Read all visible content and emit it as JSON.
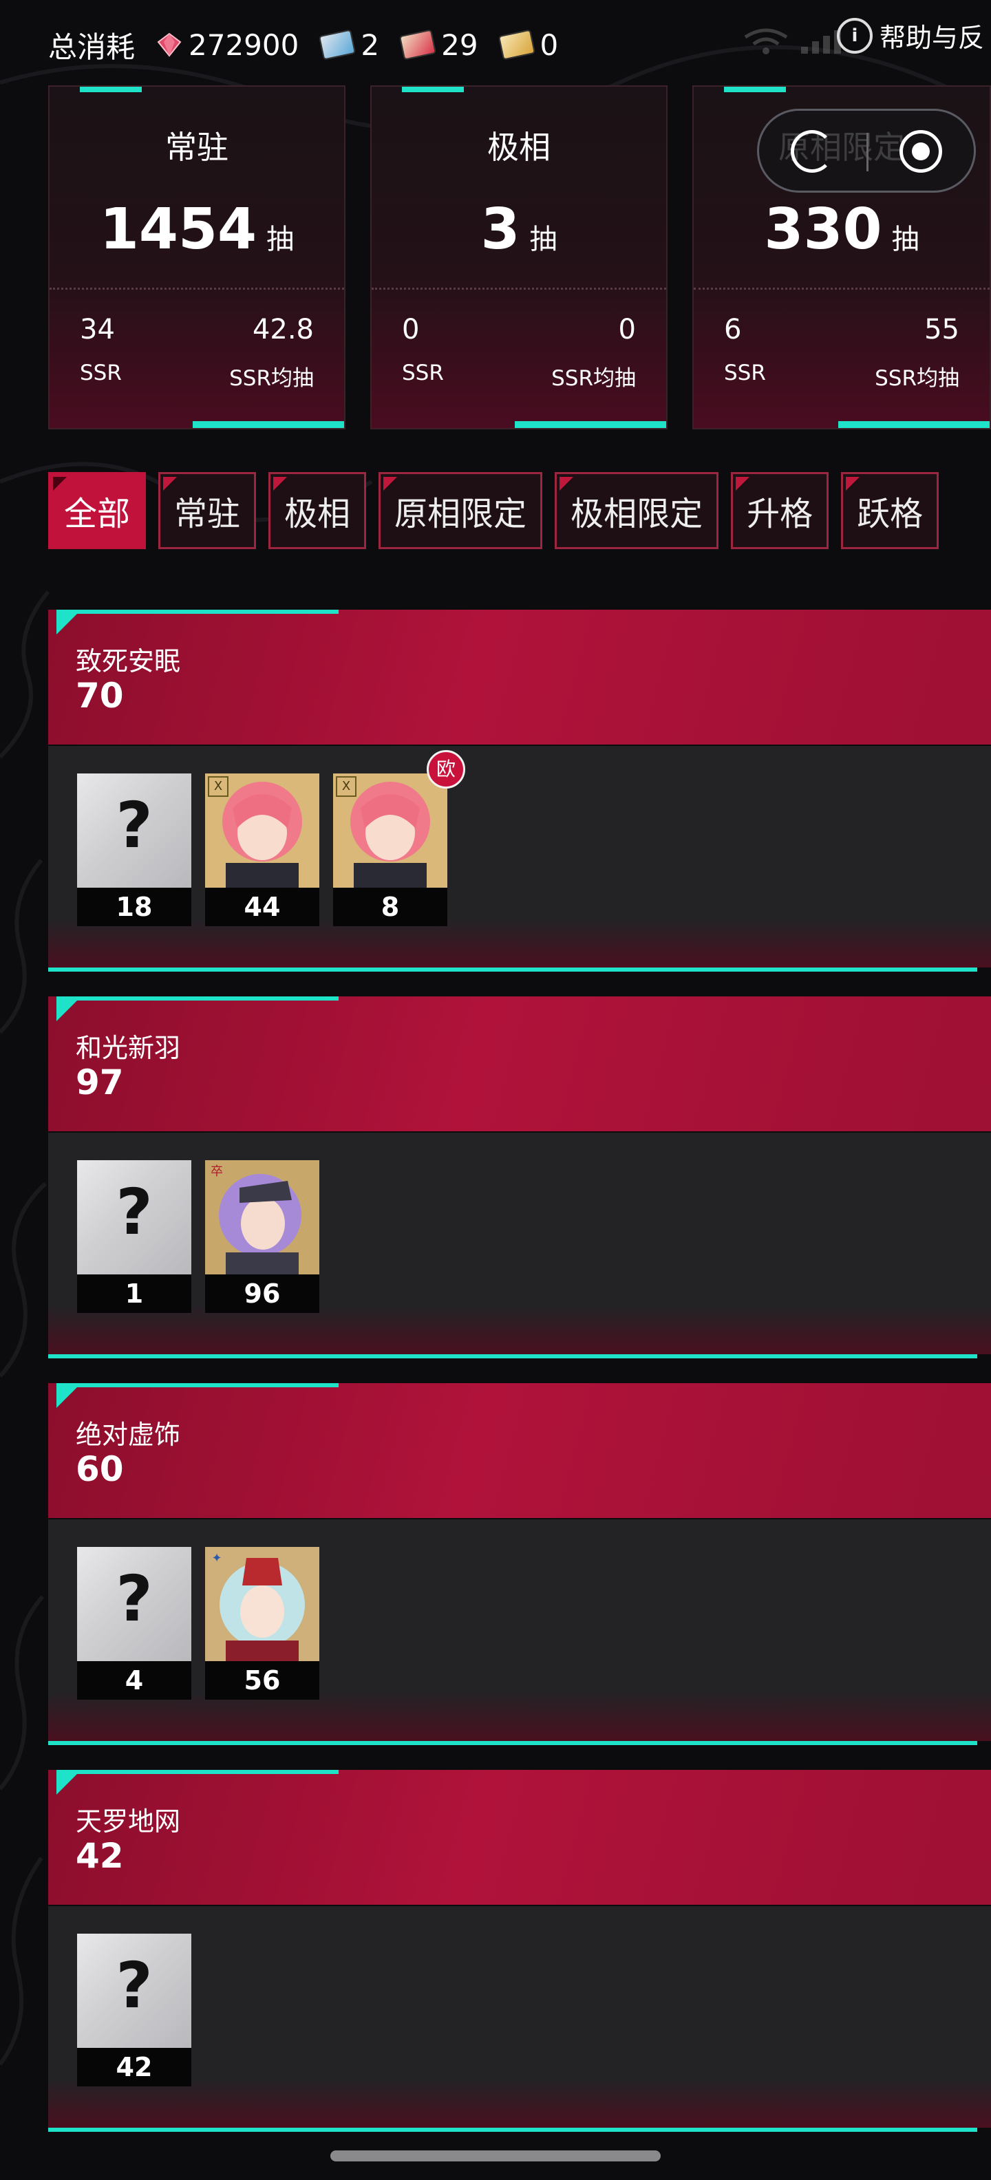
{
  "topbar": {
    "total_label": "总消耗",
    "currencies": [
      {
        "icon": "diamond-gem-icon",
        "value": "272900"
      },
      {
        "icon": "blue-ticket-icon",
        "value": "2"
      },
      {
        "icon": "red-ticket-icon",
        "value": "29"
      },
      {
        "icon": "gold-ticket-icon",
        "value": "0"
      }
    ],
    "help_label": "帮助与反"
  },
  "cards": [
    {
      "title": "常驻",
      "count": "1454",
      "unit": "抽",
      "ssr": "34",
      "ssr_label": "SSR",
      "avg": "42.8",
      "avg_label": "SSR均抽"
    },
    {
      "title": "极相",
      "count": "3",
      "unit": "抽",
      "ssr": "0",
      "ssr_label": "SSR",
      "avg": "0",
      "avg_label": "SSR均抽"
    },
    {
      "title": "原相限定",
      "count": "330",
      "unit": "抽",
      "ssr": "6",
      "ssr_label": "SSR",
      "avg": "55",
      "avg_label": "SSR均抽"
    }
  ],
  "tabs": [
    "全部",
    "常驻",
    "极相",
    "原相限定",
    "极相限定",
    "升格",
    "跃格"
  ],
  "active_tab": "全部",
  "groups": [
    {
      "name": "致死安眠",
      "count": "70",
      "chars": [
        {
          "type": "unknown",
          "pulls": "18"
        },
        {
          "type": "pink-hair",
          "pulls": "44"
        },
        {
          "type": "pink-hair",
          "pulls": "8",
          "badge": "欧"
        }
      ]
    },
    {
      "name": "和光新羽",
      "count": "97",
      "chars": [
        {
          "type": "unknown",
          "pulls": "1"
        },
        {
          "type": "purple-hair",
          "pulls": "96"
        }
      ]
    },
    {
      "name": "绝对虚饰",
      "count": "60",
      "chars": [
        {
          "type": "unknown",
          "pulls": "4"
        },
        {
          "type": "teal-hair",
          "pulls": "56"
        }
      ]
    },
    {
      "name": "天罗地网",
      "count": "42",
      "chars": [
        {
          "type": "unknown",
          "pulls": "42"
        }
      ]
    }
  ],
  "colors": {
    "accent_teal": "#1ee3c8",
    "accent_red": "#c0123a",
    "card_bg": "#1a1216"
  }
}
